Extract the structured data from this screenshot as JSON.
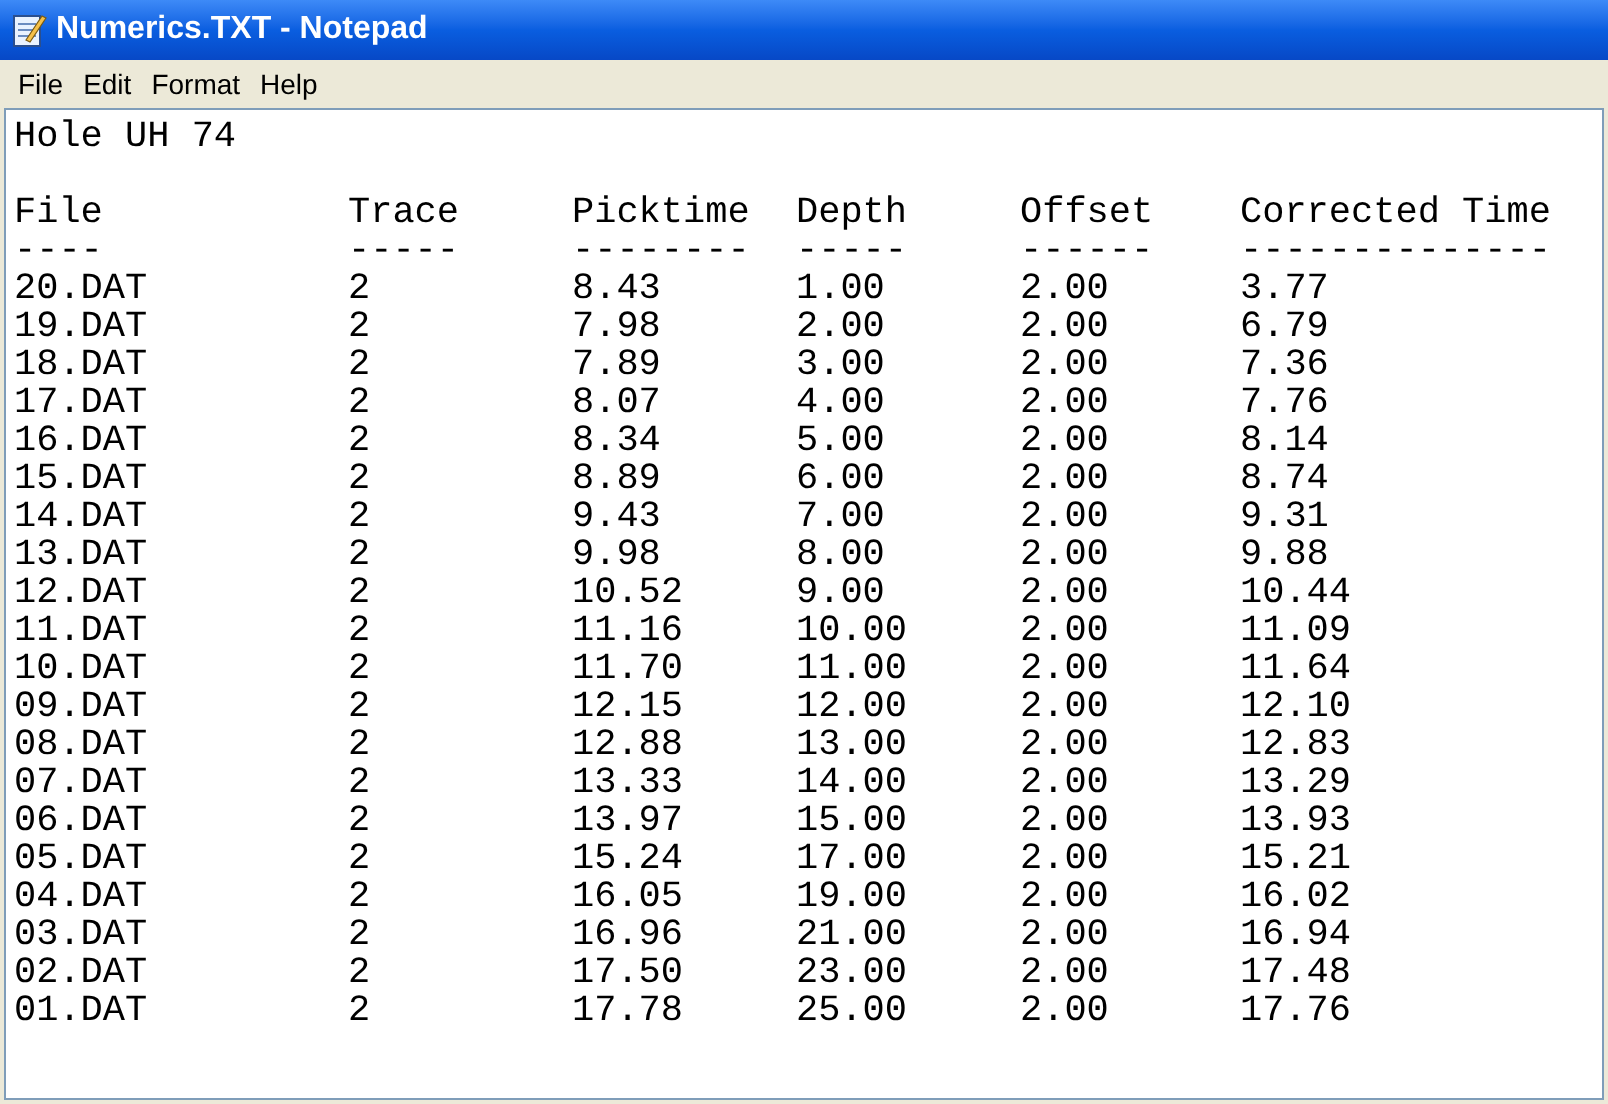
{
  "window": {
    "title": "Numerics.TXT - Notepad"
  },
  "menu": [
    "File",
    "Edit",
    "Format",
    "Help"
  ],
  "document": {
    "heading": "Hole UH 74",
    "columns": [
      {
        "label": "File",
        "rule": "----"
      },
      {
        "label": "Trace",
        "rule": "-----"
      },
      {
        "label": "Picktime",
        "rule": "--------"
      },
      {
        "label": "Depth",
        "rule": "-----"
      },
      {
        "label": "Offset",
        "rule": "------"
      },
      {
        "label": "Corrected Time",
        "rule": "--------------"
      }
    ],
    "rows": [
      [
        "20.DAT",
        "2",
        "8.43",
        "1.00",
        "2.00",
        "3.77"
      ],
      [
        "19.DAT",
        "2",
        "7.98",
        "2.00",
        "2.00",
        "6.79"
      ],
      [
        "18.DAT",
        "2",
        "7.89",
        "3.00",
        "2.00",
        "7.36"
      ],
      [
        "17.DAT",
        "2",
        "8.07",
        "4.00",
        "2.00",
        "7.76"
      ],
      [
        "16.DAT",
        "2",
        "8.34",
        "5.00",
        "2.00",
        "8.14"
      ],
      [
        "15.DAT",
        "2",
        "8.89",
        "6.00",
        "2.00",
        "8.74"
      ],
      [
        "14.DAT",
        "2",
        "9.43",
        "7.00",
        "2.00",
        "9.31"
      ],
      [
        "13.DAT",
        "2",
        "9.98",
        "8.00",
        "2.00",
        "9.88"
      ],
      [
        "12.DAT",
        "2",
        "10.52",
        "9.00",
        "2.00",
        "10.44"
      ],
      [
        "11.DAT",
        "2",
        "11.16",
        "10.00",
        "2.00",
        "11.09"
      ],
      [
        "10.DAT",
        "2",
        "11.70",
        "11.00",
        "2.00",
        "11.64"
      ],
      [
        "09.DAT",
        "2",
        "12.15",
        "12.00",
        "2.00",
        "12.10"
      ],
      [
        "08.DAT",
        "2",
        "12.88",
        "13.00",
        "2.00",
        "12.83"
      ],
      [
        "07.DAT",
        "2",
        "13.33",
        "14.00",
        "2.00",
        "13.29"
      ],
      [
        "06.DAT",
        "2",
        "13.97",
        "15.00",
        "2.00",
        "13.93"
      ],
      [
        "05.DAT",
        "2",
        "15.24",
        "17.00",
        "2.00",
        "15.21"
      ],
      [
        "04.DAT",
        "2",
        "16.05",
        "19.00",
        "2.00",
        "16.02"
      ],
      [
        "03.DAT",
        "2",
        "16.96",
        "21.00",
        "2.00",
        "16.94"
      ],
      [
        "02.DAT",
        "2",
        "17.50",
        "23.00",
        "2.00",
        "17.48"
      ],
      [
        "01.DAT",
        "2",
        "17.78",
        "25.00",
        "2.00",
        "17.76"
      ]
    ]
  }
}
